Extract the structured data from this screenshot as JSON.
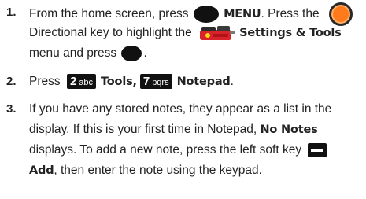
{
  "steps": [
    {
      "number": "1.",
      "line1_prefix": "From the home screen, press ",
      "menu_label": "MENU",
      "line1_suffix": ". Press the ",
      "line2_prefix": "Directional key to highlight the ",
      "settings_label": "Settings & Tools",
      "line3_prefix": "menu and press ",
      "line3_suffix": "."
    },
    {
      "number": "2.",
      "prefix": "Press ",
      "key1_digit": "2",
      "key1_letters": "abc",
      "key1_item": "Tools",
      "separator": ",",
      "key2_digit": "7",
      "key2_letters": "pqrs",
      "key2_item": "Notepad",
      "suffix": "."
    },
    {
      "number": "3.",
      "line1": "If you have any stored notes, they appear as a list in the",
      "line2_prefix": "display. If this is your first time in Notepad, ",
      "no_notes_label": "No Notes",
      "line3": "displays. To add a new note, press the left soft key ",
      "add_label": "Add",
      "line4_suffix": ", then enter the note using the keypad."
    }
  ],
  "icons": {
    "ok_key": "ok-key-icon",
    "directional_key": "directional-key-icon",
    "settings_tools": "settings-tools-icon",
    "left_soft_key": "left-soft-key-icon"
  },
  "colors": {
    "text": "#222222",
    "key_fill": "#111111",
    "nav_ring": "#ff7a1a"
  }
}
